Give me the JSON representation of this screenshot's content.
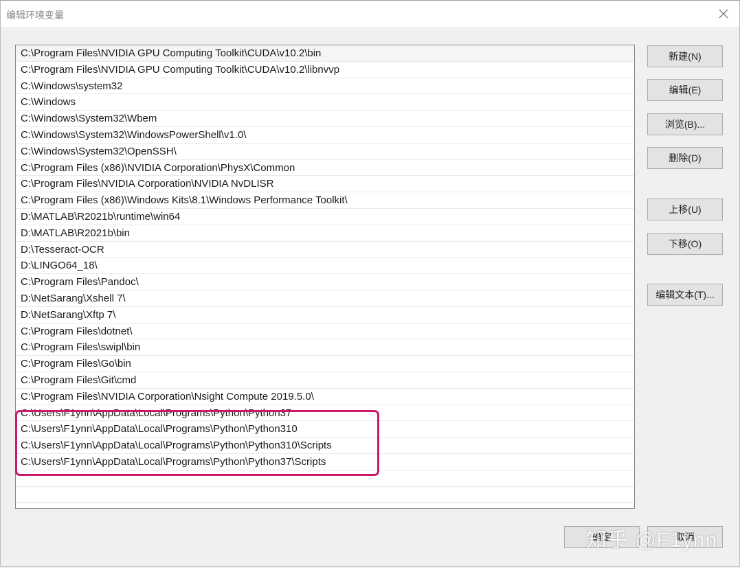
{
  "window": {
    "title": "编辑环境变量"
  },
  "icons": {
    "close": "close-icon"
  },
  "paths": [
    "C:\\Program Files\\NVIDIA GPU Computing Toolkit\\CUDA\\v10.2\\bin",
    "C:\\Program Files\\NVIDIA GPU Computing Toolkit\\CUDA\\v10.2\\libnvvp",
    "C:\\Windows\\system32",
    "C:\\Windows",
    "C:\\Windows\\System32\\Wbem",
    "C:\\Windows\\System32\\WindowsPowerShell\\v1.0\\",
    "C:\\Windows\\System32\\OpenSSH\\",
    "C:\\Program Files (x86)\\NVIDIA Corporation\\PhysX\\Common",
    "C:\\Program Files\\NVIDIA Corporation\\NVIDIA NvDLISR",
    "C:\\Program Files (x86)\\Windows Kits\\8.1\\Windows Performance Toolkit\\",
    "D:\\MATLAB\\R2021b\\runtime\\win64",
    "D:\\MATLAB\\R2021b\\bin",
    "D:\\Tesseract-OCR",
    "D:\\LINGO64_18\\",
    "C:\\Program Files\\Pandoc\\",
    "D:\\NetSarang\\Xshell 7\\",
    "D:\\NetSarang\\Xftp 7\\",
    "C:\\Program Files\\dotnet\\",
    "C:\\Program Files\\swipl\\bin",
    "C:\\Program Files\\Go\\bin",
    "C:\\Program Files\\Git\\cmd",
    "C:\\Program Files\\NVIDIA Corporation\\Nsight Compute 2019.5.0\\",
    "C:\\Users\\F1ynn\\AppData\\Local\\Programs\\Python\\Python37",
    "C:\\Users\\F1ynn\\AppData\\Local\\Programs\\Python\\Python310",
    "C:\\Users\\F1ynn\\AppData\\Local\\Programs\\Python\\Python310\\Scripts",
    "C:\\Users\\F1ynn\\AppData\\Local\\Programs\\Python\\Python37\\Scripts",
    "",
    ""
  ],
  "buttons": {
    "new": "新建(N)",
    "edit": "编辑(E)",
    "browse": "浏览(B)...",
    "delete": "删除(D)",
    "move_up": "上移(U)",
    "move_down": "下移(O)",
    "edit_text": "编辑文本(T)...",
    "ok": "确定",
    "cancel": "取消"
  },
  "watermark": "知乎 @F1ynn",
  "colors": {
    "highlight": "#c8196b",
    "dialog_bg": "#f0f0f0"
  }
}
